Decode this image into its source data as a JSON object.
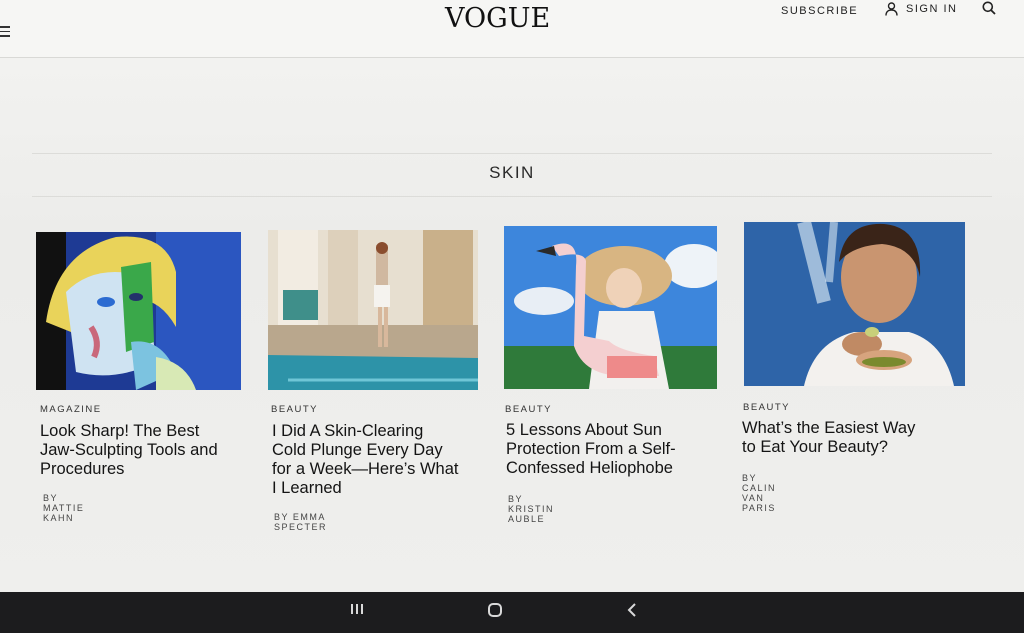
{
  "header": {
    "logo": "VOGUE",
    "subscribe_label": "SUBSCRIBE",
    "signin_label": "SIGN IN",
    "icons": [
      "menu-icon",
      "user-icon",
      "search-icon"
    ]
  },
  "section": {
    "title": "SKIN"
  },
  "articles": [
    {
      "category": "MAGAZINE",
      "headline_lines": [
        "Look Sharp! The Best",
        "Jaw-Sculpting Tools and",
        "Procedures"
      ],
      "byline": "BY MATTIE KAHN"
    },
    {
      "category": "BEAUTY",
      "headline_lines": [
        "I Did A Skin-Clearing",
        "Cold Plunge Every Day",
        "for a Week—Here’s What",
        "I Learned"
      ],
      "byline": "BY EMMA SPECTER"
    },
    {
      "category": "BEAUTY",
      "headline_lines": [
        "5 Lessons About Sun",
        "Protection From a Self-",
        "Confessed Heliophobe"
      ],
      "byline": "BY KRISTIN AUBLE"
    },
    {
      "category": "BEAUTY",
      "headline_lines": [
        "What’s the Easiest Way",
        "to Eat Your Beauty?"
      ],
      "byline": "BY CALIN VAN PARIS"
    }
  ],
  "system_nav": {
    "icons": [
      "recent-apps-icon",
      "home-icon",
      "back-icon"
    ]
  }
}
